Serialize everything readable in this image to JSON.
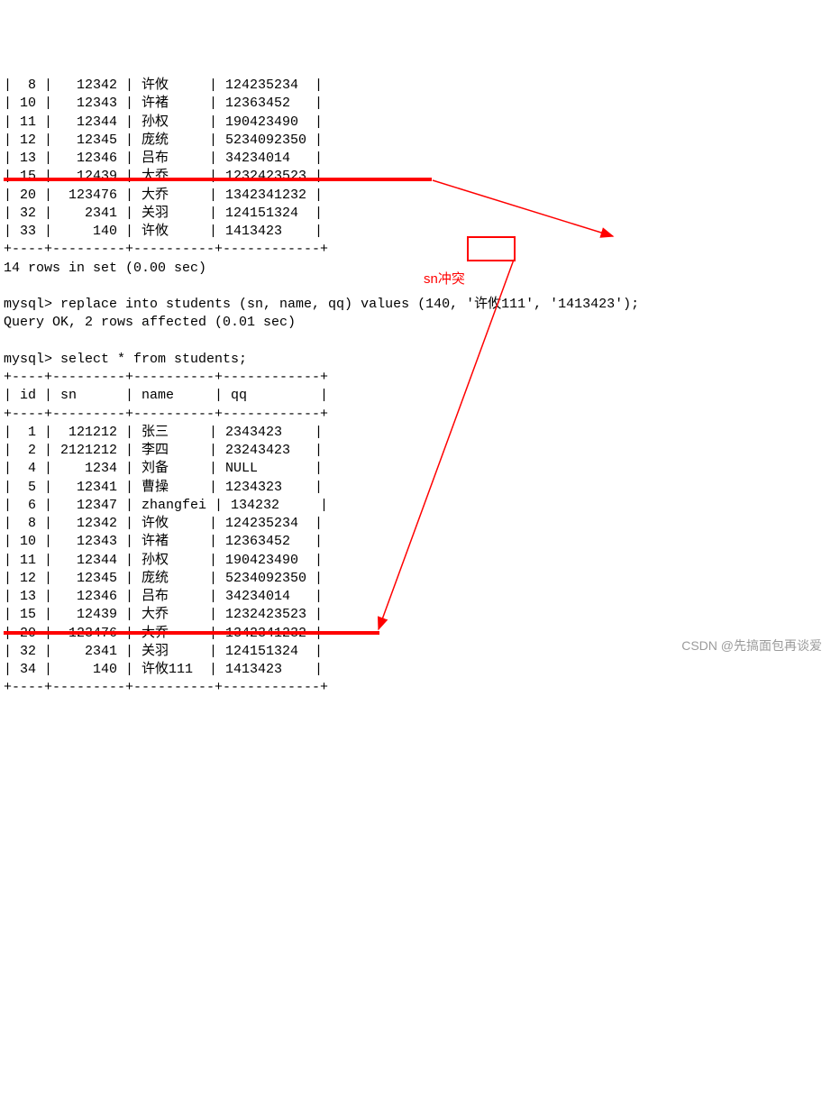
{
  "top_table_rows": [
    {
      "id": "8",
      "sn": "12342",
      "name": "许攸",
      "qq": "124235234"
    },
    {
      "id": "10",
      "sn": "12343",
      "name": "许褚",
      "qq": "12363452"
    },
    {
      "id": "11",
      "sn": "12344",
      "name": "孙权",
      "qq": "190423490"
    },
    {
      "id": "12",
      "sn": "12345",
      "name": "庞统",
      "qq": "5234092350"
    },
    {
      "id": "13",
      "sn": "12346",
      "name": "吕布",
      "qq": "34234014"
    },
    {
      "id": "15",
      "sn": "12439",
      "name": "大乔",
      "qq": "1232423523"
    },
    {
      "id": "20",
      "sn": "123476",
      "name": "大乔",
      "qq": "1342341232"
    },
    {
      "id": "32",
      "sn": "2341",
      "name": "关羽",
      "qq": "124151324"
    },
    {
      "id": "33",
      "sn": "140",
      "name": "许攸",
      "qq": "1413423"
    }
  ],
  "top_footer_border": "+----+---------+----------+------------+",
  "top_summary": "14 rows in set (0.00 sec)",
  "blank": "",
  "cmd_replace": "mysql> replace into students (sn, name, qq) values (140, '许攸111', '1413423');",
  "cmd_replace_result": "Query OK, 2 rows affected (0.01 sec)",
  "annotation_conflict": "sn冲突",
  "cmd_select": "mysql> select * from students;",
  "table_border": "+----+---------+----------+------------+",
  "table_header": "| id | sn      | name     | qq         |",
  "bottom_table_rows": [
    {
      "id": "1",
      "sn": "121212",
      "name": "张三",
      "qq": "2343423"
    },
    {
      "id": "2",
      "sn": "2121212",
      "name": "李四",
      "qq": "23243423"
    },
    {
      "id": "4",
      "sn": "1234",
      "name": "刘备",
      "qq": "NULL"
    },
    {
      "id": "5",
      "sn": "12341",
      "name": "曹操",
      "qq": "1234323"
    },
    {
      "id": "6",
      "sn": "12347",
      "name": "zhangfei",
      "qq": "134232"
    },
    {
      "id": "8",
      "sn": "12342",
      "name": "许攸",
      "qq": "124235234"
    },
    {
      "id": "10",
      "sn": "12343",
      "name": "许褚",
      "qq": "12363452"
    },
    {
      "id": "11",
      "sn": "12344",
      "name": "孙权",
      "qq": "190423490"
    },
    {
      "id": "12",
      "sn": "12345",
      "name": "庞统",
      "qq": "5234092350"
    },
    {
      "id": "13",
      "sn": "12346",
      "name": "吕布",
      "qq": "34234014"
    },
    {
      "id": "15",
      "sn": "12439",
      "name": "大乔",
      "qq": "1232423523"
    },
    {
      "id": "20",
      "sn": "123476",
      "name": "大乔",
      "qq": "1342341232"
    },
    {
      "id": "32",
      "sn": "2341",
      "name": "关羽",
      "qq": "124151324"
    },
    {
      "id": "34",
      "sn": "140",
      "name": "许攸111",
      "qq": "1413423"
    }
  ],
  "watermark": "CSDN @先搞面包再谈爱"
}
